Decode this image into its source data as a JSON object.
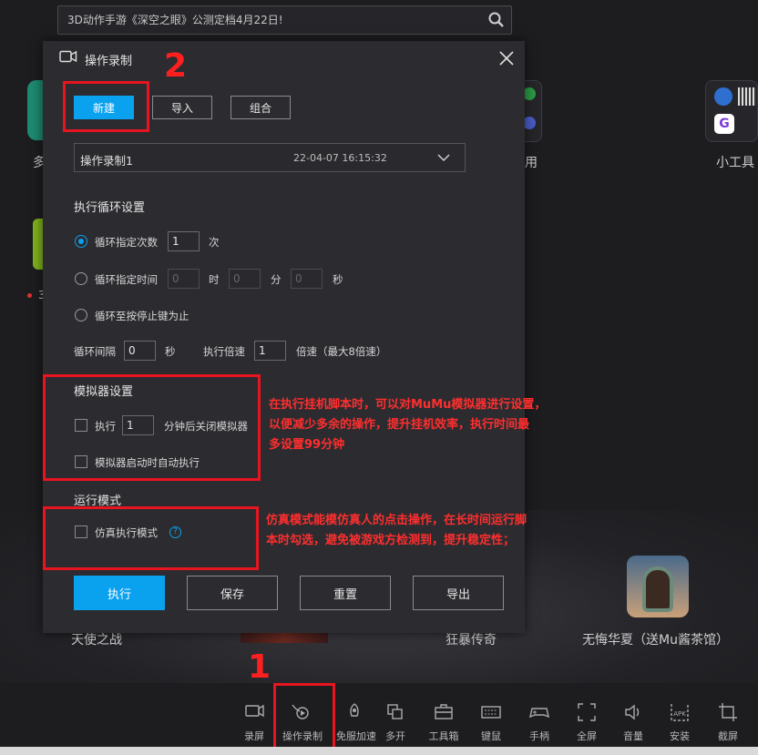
{
  "search": {
    "text": "3D动作手游《深空之眼》公测定档4月22日!"
  },
  "dialog": {
    "title": "操作录制",
    "buttons": {
      "new": "新建",
      "import": "导入",
      "combine": "组合"
    },
    "record": {
      "name": "操作录制1",
      "time": "22-04-07 16:15:32"
    },
    "loop": {
      "title": "执行循环设置",
      "count_label": "循环指定次数",
      "count_value": "1",
      "count_unit": "次",
      "time_label": "循环指定时间",
      "hour_value": "0",
      "hour_unit": "时",
      "min_value": "0",
      "min_unit": "分",
      "sec_value": "0",
      "sec_unit": "秒",
      "until_stop_label": "循环至按停止键为止",
      "interval_label": "循环间隔",
      "interval_value": "0",
      "interval_unit": "秒",
      "speed_label": "执行倍速",
      "speed_value": "1",
      "speed_unit": "倍速（最大8倍速）"
    },
    "emulator": {
      "title": "模拟器设置",
      "exec_label": "执行",
      "exec_value": "1",
      "exec_suffix": "分钟后关闭模拟器",
      "autostart_label": "模拟器启动时自动执行"
    },
    "run_mode": {
      "title": "运行模式",
      "sim_label": "仿真执行模式",
      "help": "?"
    },
    "actions": {
      "execute": "执行",
      "save": "保存",
      "reset": "重置",
      "export": "导出"
    }
  },
  "annotations": {
    "num1": "1",
    "num2": "2",
    "emulator_note": [
      "在执行挂机脚本时，可以对MuMu模拟器进行设置，",
      "以便减少多余的操作，提升挂机效率，执行时间最",
      "多设置99分钟"
    ],
    "sim_note": [
      "仿真模式能模仿真人的点击操作，在长时间运行脚",
      "本时勾选，避免被游戏方检测到，提升稳定性；"
    ]
  },
  "background": {
    "left_partial": "多",
    "right_partial": "用",
    "tools_label": "小工具",
    "red_dot_partial": "3",
    "games": [
      "天使之战",
      "狂暴传奇",
      "无悔华夏（送Mu酱茶馆）"
    ]
  },
  "toolbar": [
    {
      "label": "录屏",
      "icon": "record-screen-icon"
    },
    {
      "label": "操作录制",
      "icon": "operation-record-icon"
    },
    {
      "label": "免服加速",
      "icon": "rocket-icon"
    },
    {
      "label": "多开",
      "icon": "multi-instance-icon"
    },
    {
      "label": "工具箱",
      "icon": "toolbox-icon"
    },
    {
      "label": "键鼠",
      "icon": "keyboard-icon"
    },
    {
      "label": "手柄",
      "icon": "gamepad-icon"
    },
    {
      "label": "全屏",
      "icon": "fullscreen-icon"
    },
    {
      "label": "音量",
      "icon": "volume-icon"
    },
    {
      "label": "安装",
      "icon": "apk-install-icon"
    },
    {
      "label": "截屏",
      "icon": "screenshot-icon"
    }
  ],
  "colors": {
    "accent": "#0aa1ef",
    "highlight": "#e8141f",
    "dialog_bg": "#2c2c30",
    "page_bg": "#1d1d20"
  }
}
